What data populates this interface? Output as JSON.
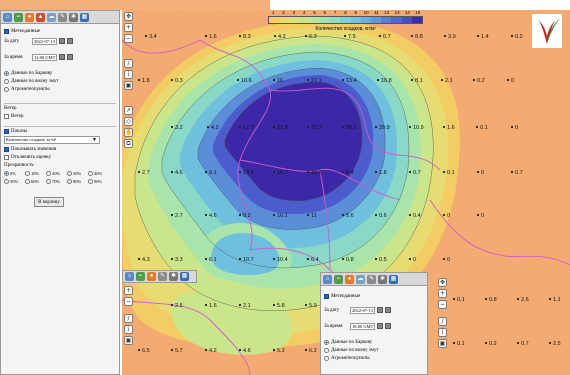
{
  "panel": {
    "meteo_label": "Метеоданные",
    "from_label": "За дату",
    "from_date": "2022-07-13",
    "to_label": "За время",
    "to_time": "12:00 GMT",
    "sources": [
      "Данные по Баркову",
      "Данные по волну змут",
      "Агрометеопункты"
    ],
    "wind_heading": "Ветер",
    "wind_label": "Ветер",
    "show_heading": "Показы",
    "param_select": "Количество осадков, кг/м²",
    "show_values": "Показывать значения",
    "clear_values": "Отключить оценку",
    "opacity_label": "Прозрачность",
    "opacity_options": [
      "0%",
      "10%",
      "20%",
      "30%",
      "40%",
      "50%",
      "60%",
      "70%",
      "80%",
      "90%"
    ],
    "action_button": "В корзину"
  },
  "panel2": {
    "meteo_label": "Метеоданные",
    "from_label": "За дату",
    "from_date": "2022-07-13",
    "to_label": "За время",
    "to_time": "18:00 GMT",
    "sources": [
      "Данные по Баркову",
      "Данные по волну змут",
      "Агрометеопункты"
    ]
  },
  "legend": {
    "title": "Количество осадков, кг/м²",
    "levels": [
      "1",
      "2",
      "3",
      "4",
      "5",
      "6",
      "7",
      "8",
      "9",
      "10",
      "11",
      "12",
      "13",
      "14",
      "15"
    ],
    "colors": [
      "#f6d05e",
      "#ecd96a",
      "#dde27c",
      "#c8e58d",
      "#b3e6a2",
      "#9ee3b4",
      "#8ddcc4",
      "#7fd2d4",
      "#74c2dd",
      "#6aaedf",
      "#6098dc",
      "#5880d6",
      "#5167cf",
      "#4a4ec6",
      "#3e2aa8"
    ]
  },
  "stations": [
    "3.4",
    "1.6",
    "8.3",
    "4.2",
    "6.3",
    "7.5",
    "0.7",
    "8.8",
    "3.9",
    "1.4",
    "0.2",
    "0",
    "1.8",
    "0.3",
    "10.6",
    "16",
    "27.1",
    "13.4",
    "16.8",
    "8.1",
    "2.1",
    "0.2",
    "0",
    "3.2",
    "4.2",
    "17.7",
    "21.8",
    "33.7",
    "30.9",
    "29.9",
    "10.9",
    "1.6",
    "0.1",
    "0",
    "2.7",
    "4.6",
    "9.1",
    "13.5",
    "16.7",
    "15.3",
    "6.4",
    "1.8",
    "0.7",
    "0.1",
    "0",
    "0.7",
    "2.7",
    "4.6",
    "9.2",
    "16.1",
    "11",
    "5.6",
    "0.6",
    "0.4",
    "0",
    "0",
    "4.3",
    "3.3",
    "6.1",
    "10.7",
    "10.4",
    "6.4",
    "0.8",
    "0.5",
    "0",
    "0",
    "2.5",
    "1.6",
    "2.1",
    "5.8",
    "5.9",
    "1.6",
    "0",
    "0.1",
    "0.8",
    "2.6",
    "1.1",
    "6.5",
    "5.7",
    "4.2",
    "4.6",
    "5.2",
    "6.2",
    "0.1",
    "0.2",
    "0.7",
    "2.5"
  ]
}
